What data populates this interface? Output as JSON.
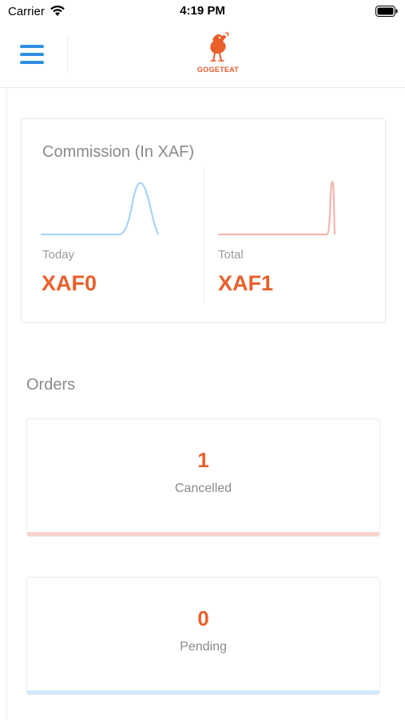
{
  "status_bar": {
    "carrier": "Carrier",
    "time": "4:19 PM"
  },
  "nav": {
    "logo_text": "GOGETEAT"
  },
  "commission": {
    "title": "Commission (In XAF)",
    "today": {
      "label": "Today",
      "value": "XAF0"
    },
    "total": {
      "label": "Total",
      "value": "XAF1"
    }
  },
  "orders": {
    "heading": "Orders",
    "cards": [
      {
        "count": "1",
        "label": "Cancelled",
        "bar_color": "#f7d3cc"
      },
      {
        "count": "0",
        "label": "Pending",
        "bar_color": "#d3e8fb"
      }
    ]
  },
  "colors": {
    "accent": "#e8602c",
    "menu_blue": "#2f8fe0",
    "sparkline_blue": "#a9d3f7",
    "sparkline_red": "#f2b6aa"
  },
  "icons": [
    "wifi-icon",
    "battery-icon",
    "menu-icon",
    "logo-icon"
  ]
}
